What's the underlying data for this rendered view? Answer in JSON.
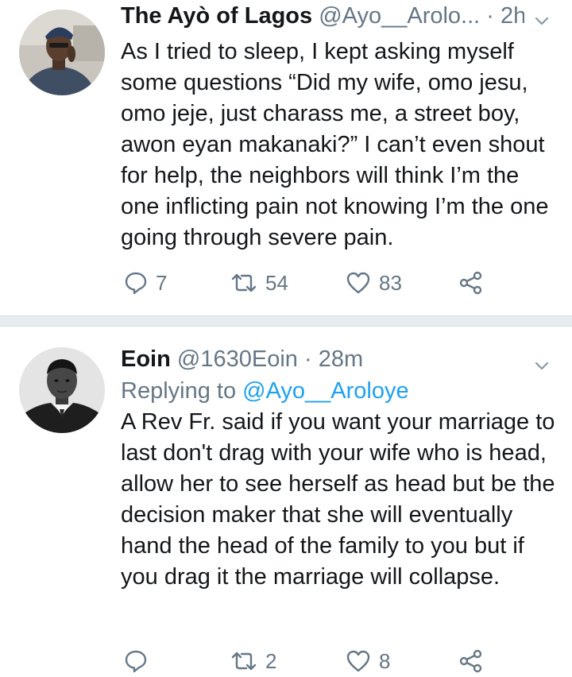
{
  "tweets": [
    {
      "display_name": "The Ayò of Lagos",
      "handle": "@Ayo__Arolo...",
      "separator": "·",
      "time": "2h",
      "body": "As I tried to sleep, I kept asking myself some questions “Did my wife, omo jesu, omo jeje, just charass me, a street boy, awon eyan makanaki?” I can’t even shout for help, the neighbors will think I’m the one inflicting pain not knowing I’m the one going through severe pain.",
      "replies": "7",
      "retweets": "54",
      "likes": "83"
    },
    {
      "display_name": "Eoin",
      "handle": "@1630Eoin",
      "separator": "·",
      "time": "28m",
      "replying_prefix": "Replying to",
      "replying_to": "@Ayo__Aroloye",
      "body": "A Rev Fr. said if you want your marriage to last don't drag with your wife who is head, allow her to see herself as head but be the decision maker that she will eventually hand the head of the family to you but if you drag it the marriage will collapse.",
      "replies": "",
      "retweets": "2",
      "likes": "8"
    }
  ],
  "icons": {
    "menu": "chevron-down-icon",
    "reply": "reply-icon",
    "retweet": "retweet-icon",
    "like": "heart-icon",
    "share": "share-icon"
  },
  "colors": {
    "text": "#14171a",
    "secondary": "#657786",
    "link": "#1da1f2",
    "divider": "#e6ecf0"
  }
}
